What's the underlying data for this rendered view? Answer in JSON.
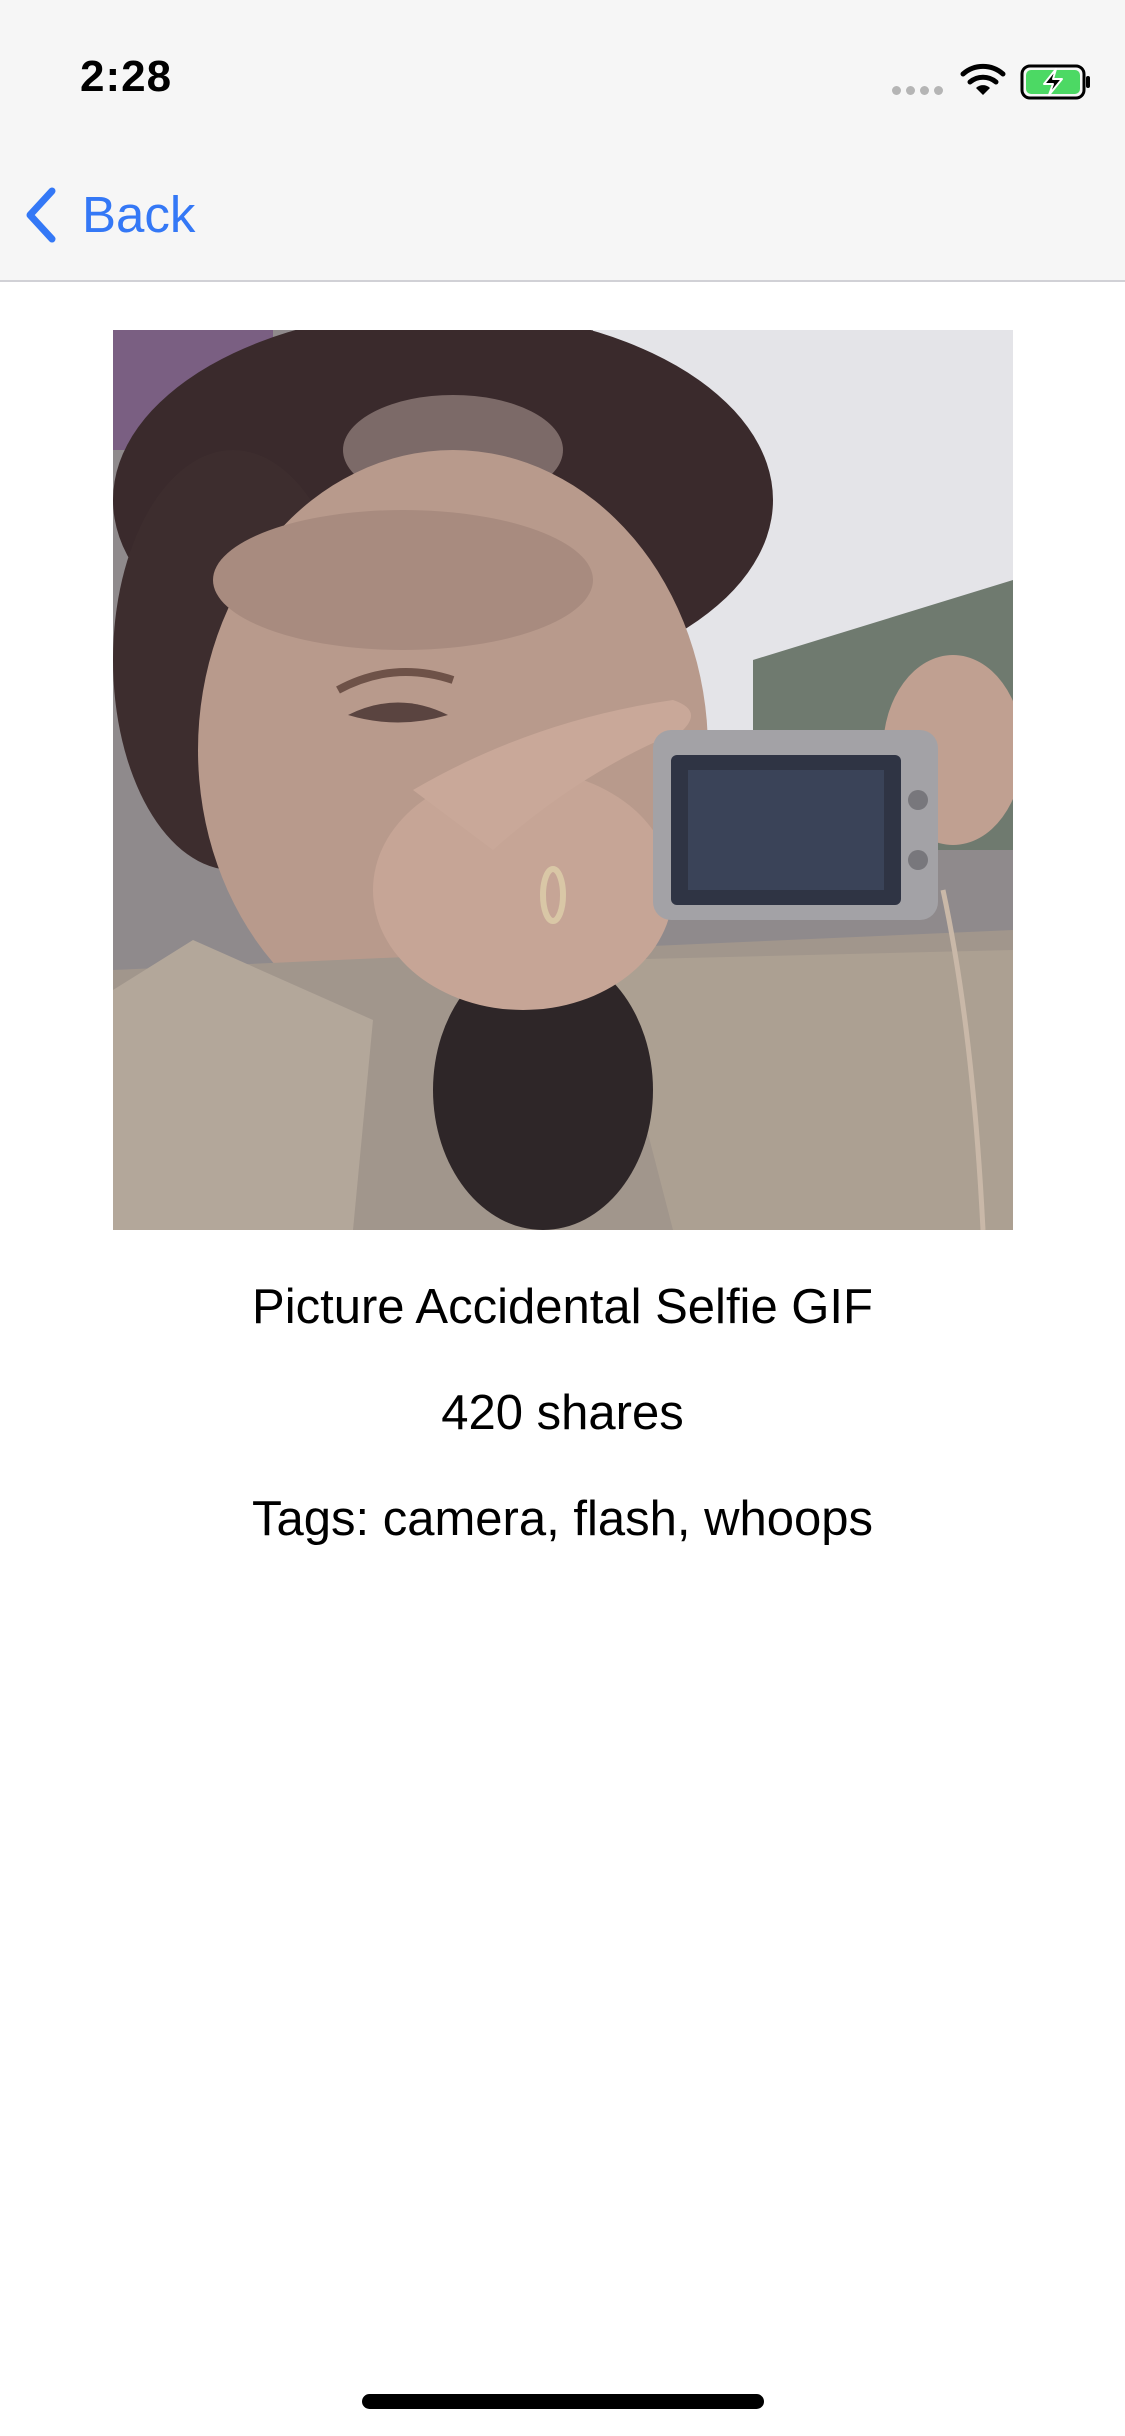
{
  "status_bar": {
    "time": "2:28",
    "icons": [
      "signal-dots-icon",
      "wifi-icon",
      "battery-charging-icon"
    ]
  },
  "nav_bar": {
    "back_label": "Back",
    "back_icon": "chevron-left-icon"
  },
  "gif": {
    "title": "Picture Accidental Selfie GIF",
    "shares": "420 shares",
    "tags": "Tags: camera, flash, whoops"
  },
  "colors": {
    "accent": "#3478f6",
    "nav_background": "#f6f6f6",
    "battery_fill": "#4cd964"
  }
}
